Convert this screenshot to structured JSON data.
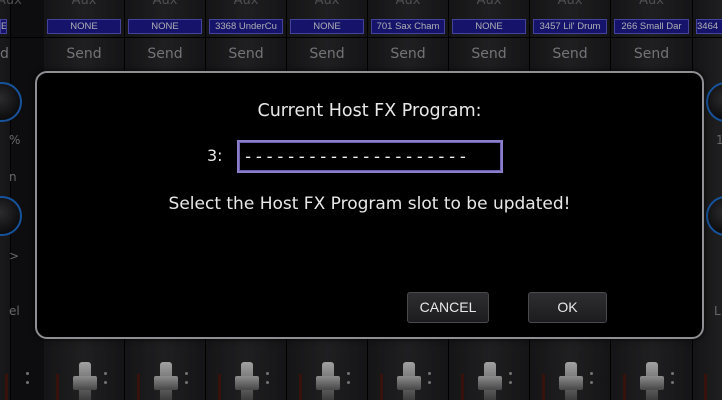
{
  "strips": [
    {
      "aux": "Aux",
      "program": "E",
      "send": "d"
    },
    {
      "aux": "Aux",
      "program": "NONE",
      "send": "Send"
    },
    {
      "aux": "Aux",
      "program": "NONE",
      "send": "Send"
    },
    {
      "aux": "Aux",
      "program": "3368 UnderCu",
      "send": "Send"
    },
    {
      "aux": "Aux",
      "program": "NONE",
      "send": "Send"
    },
    {
      "aux": "Aux",
      "program": "701 Sax Cham",
      "send": "Send"
    },
    {
      "aux": "Aux",
      "program": "NONE",
      "send": "Send"
    },
    {
      "aux": "Aux",
      "program": "3457 Lil' Drum",
      "send": "Send"
    },
    {
      "aux": "Aux",
      "program": "266 Small Dar",
      "send": "Send"
    },
    {
      "aux": "",
      "program": "3464",
      "send": "S"
    }
  ],
  "edge_labels": {
    "left": [
      "%",
      "n",
      ">",
      "el"
    ],
    "right": [
      "1",
      "L"
    ]
  },
  "dialog": {
    "title": "Current Host FX Program:",
    "slot_number": "3:",
    "program_name_value": "---------------------",
    "message": "Select the Host FX Program slot to be updated!",
    "cancel_label": "CANCEL",
    "ok_label": "OK"
  },
  "colors": {
    "program_label_bg": "#1d1b8e",
    "input_border": "#8a7fc8",
    "dialog_border": "#8f8f93",
    "knob_ring": "#1f6fd1"
  }
}
